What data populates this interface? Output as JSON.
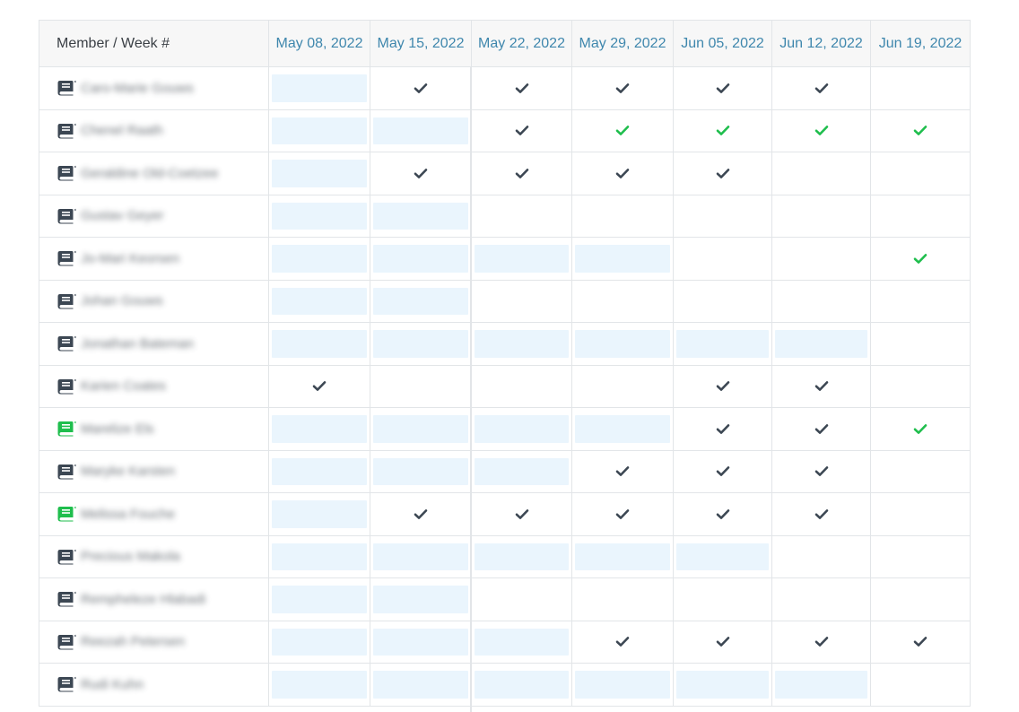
{
  "table": {
    "member_header": "Member / Week #",
    "weeks": [
      "May 08, 2022",
      "May 15, 2022",
      "May 22, 2022",
      "May 29, 2022",
      "Jun 05, 2022",
      "Jun 12, 2022",
      "Jun 19, 2022"
    ],
    "colors": {
      "header_text": "#3f87ad",
      "check_dark": "#3c4753",
      "check_green": "#1fbe4d",
      "shaded_cell": "#eaf5fd",
      "book_default": "#3c4753",
      "book_green": "#1fbe4d"
    },
    "legend": {
      "values": "s = shaded (inactive) cell, d = dark check, g = green check, empty string = blank",
      "book_icon": "book-icon"
    },
    "rows": [
      {
        "name": "Caro-Marie Gouws",
        "book": "default",
        "cells": [
          "s",
          "d",
          "d",
          "d",
          "d",
          "d",
          ""
        ]
      },
      {
        "name": "Chenel Raath",
        "book": "default",
        "cells": [
          "s",
          "s",
          "d",
          "g",
          "g",
          "g",
          "g"
        ]
      },
      {
        "name": "Geraldine Old-Coetzee",
        "book": "default",
        "cells": [
          "s",
          "d",
          "d",
          "d",
          "d",
          "",
          ""
        ]
      },
      {
        "name": "Gustav Geyer",
        "book": "default",
        "cells": [
          "s",
          "s",
          "",
          "",
          "",
          "",
          ""
        ]
      },
      {
        "name": "Jo-Mari Keorsen",
        "book": "default",
        "cells": [
          "s",
          "s",
          "s",
          "s",
          "",
          "",
          "g"
        ]
      },
      {
        "name": "Johan Gouws",
        "book": "default",
        "cells": [
          "s",
          "s",
          "",
          "",
          "",
          "",
          ""
        ]
      },
      {
        "name": "Jonathan Bateman",
        "book": "default",
        "cells": [
          "s",
          "s",
          "s",
          "s",
          "s",
          "s",
          ""
        ]
      },
      {
        "name": "Karien Coates",
        "book": "default",
        "cells": [
          "d",
          "",
          "",
          "",
          "d",
          "d",
          ""
        ]
      },
      {
        "name": "Marelize Els",
        "book": "green",
        "cells": [
          "s",
          "s",
          "s",
          "s",
          "d",
          "d",
          "g"
        ]
      },
      {
        "name": "Maryke Karsten",
        "book": "default",
        "cells": [
          "s",
          "s",
          "s",
          "d",
          "d",
          "d",
          ""
        ]
      },
      {
        "name": "Melissa Fouche",
        "book": "green",
        "cells": [
          "s",
          "d",
          "d",
          "d",
          "d",
          "d",
          ""
        ]
      },
      {
        "name": "Precious Makola",
        "book": "default",
        "cells": [
          "s",
          "s",
          "s",
          "s",
          "s",
          "",
          ""
        ]
      },
      {
        "name": "Rempheleze Hlabadi",
        "book": "default",
        "cells": [
          "s",
          "s",
          "",
          "",
          "",
          "",
          ""
        ]
      },
      {
        "name": "Reezah Petersen",
        "book": "default",
        "cells": [
          "s",
          "s",
          "s",
          "d",
          "d",
          "d",
          "d"
        ]
      },
      {
        "name": "Rudi Kuhn",
        "book": "default",
        "cells": [
          "s",
          "s",
          "s",
          "s",
          "s",
          "s",
          ""
        ]
      }
    ]
  }
}
